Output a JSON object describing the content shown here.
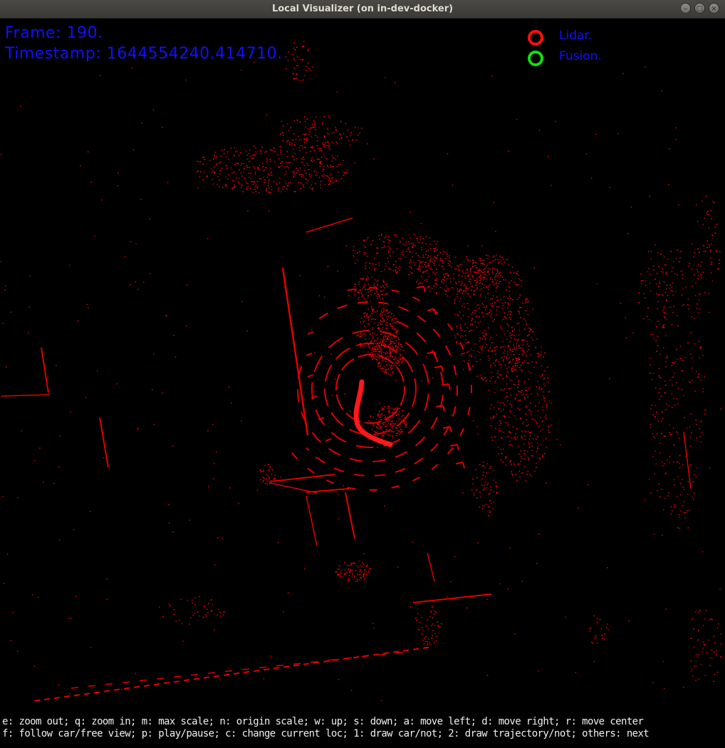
{
  "window": {
    "title": "Local Visualizer (on in-dev-docker)"
  },
  "hud": {
    "frame_text": "Frame: 190.",
    "timestamp_text": "Timestamp: 1644554240.414710."
  },
  "legend": [
    {
      "label": "Lidar.",
      "color": "#ff1010"
    },
    {
      "label": "Fusion.",
      "color": "#10e010"
    }
  ],
  "help": {
    "line1": "e: zoom out; q: zoom in; m: max scale; n: origin scale; w: up; s: down; a: move left; d: move right; r: move center",
    "line2": "f: follow car/free view; p: play/pause; c: change current loc; 1: draw car/not; 2: draw trajectory/not; others: next"
  },
  "colors": {
    "background": "#000000",
    "lidar_points": "#e00000",
    "hud_text": "#1010ff",
    "help_text": "#f0f0f0"
  }
}
